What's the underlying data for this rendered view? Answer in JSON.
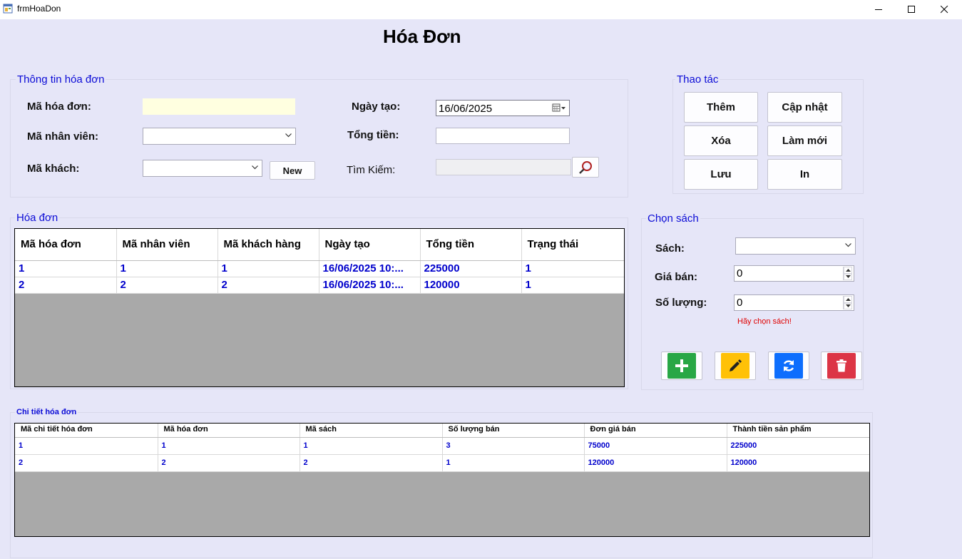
{
  "window": {
    "title": "frmHoaDon"
  },
  "form": {
    "title": "Hóa Đơn"
  },
  "info_group": {
    "title": "Thông tin hóa đơn",
    "ma_hoa_don_label": "Mã hóa đơn:",
    "ma_hoa_don_value": "",
    "ma_nhan_vien_label": "Mã nhân viên:",
    "ma_nhan_vien_value": "",
    "ma_khach_label": "Mã khách:",
    "ma_khach_value": "",
    "new_button": "New",
    "ngay_tao_label": "Ngày tạo:",
    "ngay_tao_value": "16/06/2025",
    "tong_tien_label": "Tổng tiền:",
    "tong_tien_value": "",
    "tim_kiem_label": "Tìm Kiếm:",
    "tim_kiem_value": ""
  },
  "actions_group": {
    "title": "Thao tác",
    "them": "Thêm",
    "cap_nhat": "Cập nhật",
    "xoa": "Xóa",
    "lam_moi": "Làm mới",
    "luu": "Lưu",
    "in": "In"
  },
  "invoice_group": {
    "title": "Hóa đơn",
    "columns": [
      "Mã hóa đơn",
      "Mã nhân viên",
      "Mã khách hàng",
      "Ngày tạo",
      "Tổng tiền",
      "Trạng thái"
    ],
    "rows": [
      [
        "1",
        "1",
        "1",
        "16/06/2025 10:...",
        "225000",
        "1"
      ],
      [
        "2",
        "2",
        "2",
        "16/06/2025 10:...",
        "120000",
        "1"
      ]
    ]
  },
  "book_group": {
    "title": "Chọn sách",
    "sach_label": "Sách:",
    "sach_value": "",
    "gia_ban_label": "Giá bán:",
    "gia_ban_value": "0",
    "so_luong_label": "Số lượng:",
    "so_luong_value": "0",
    "error_text": "Hãy chọn sách!",
    "button_colors": {
      "add": "#28a745",
      "edit": "#ffc107",
      "refresh": "#0d6efd",
      "delete": "#dc3545"
    }
  },
  "detail_group": {
    "title": "Chi tiết hóa đơn",
    "columns": [
      "Mã chi tiết hóa đơn",
      "Mã hóa đơn",
      "Mã sách",
      "Số lượng bán",
      "Đơn giá bán",
      "Thành tiền sản phẩm"
    ],
    "rows": [
      [
        "1",
        "1",
        "1",
        "3",
        "75000",
        "225000"
      ],
      [
        "2",
        "2",
        "2",
        "1",
        "120000",
        "120000"
      ]
    ]
  }
}
